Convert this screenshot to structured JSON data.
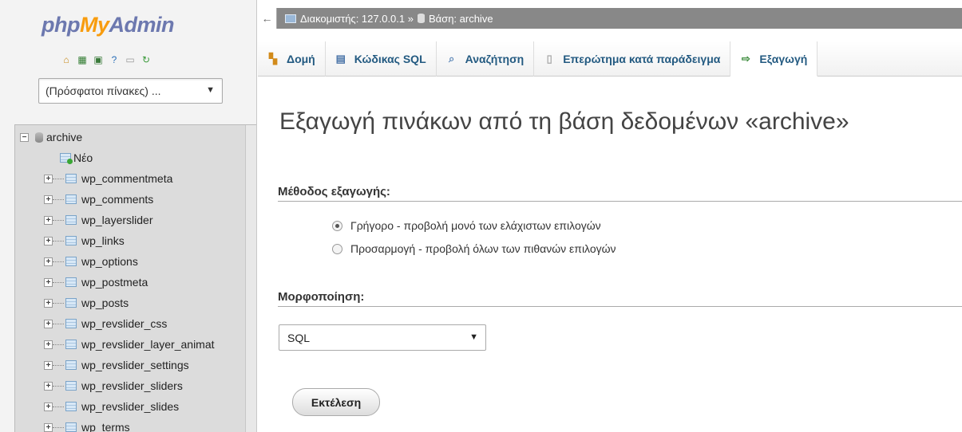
{
  "logo": {
    "php": "php",
    "my": "My",
    "admin": "Admin"
  },
  "sidebar": {
    "quick_icons": [
      "home-icon",
      "grid-icon",
      "sql-icon",
      "help-icon",
      "docs-icon",
      "reload-icon"
    ],
    "recent_select": "(Πρόσφατοι πίνακες) ...",
    "tree": {
      "database": "archive",
      "new_label": "Νέο",
      "tables": [
        "wp_commentmeta",
        "wp_comments",
        "wp_layerslider",
        "wp_links",
        "wp_options",
        "wp_postmeta",
        "wp_posts",
        "wp_revslider_css",
        "wp_revslider_layer_animat",
        "wp_revslider_settings",
        "wp_revslider_sliders",
        "wp_revslider_slides",
        "wp_terms"
      ]
    }
  },
  "breadcrumb": {
    "server_label": "Διακομιστής: 127.0.0.1 »",
    "db_label": "Βάση: archive"
  },
  "tabs": [
    {
      "label": "Δομή",
      "icon": "structure-icon"
    },
    {
      "label": "Κώδικας SQL",
      "icon": "sql-icon"
    },
    {
      "label": "Αναζήτηση",
      "icon": "search-icon"
    },
    {
      "label": "Επερώτημα κατά παράδειγμα",
      "icon": "query-icon"
    },
    {
      "label": "Εξαγωγή",
      "icon": "export-icon"
    }
  ],
  "main": {
    "title": "Εξαγωγή πινάκων από τη βάση δεδομένων «archive»",
    "method_heading": "Μέθοδος εξαγωγής:",
    "method_quick": "Γρήγορο - προβολή μονό των ελάχιστων επιλογών",
    "method_custom": "Προσαρμογή - προβολή όλων των πιθανών επιλογών",
    "format_heading": "Μορφοποίηση:",
    "format_value": "SQL",
    "go_label": "Εκτέλεση"
  }
}
